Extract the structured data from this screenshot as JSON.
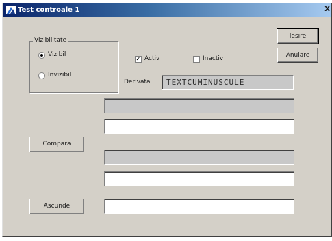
{
  "window": {
    "title": "Test controale 1",
    "close_label": "X"
  },
  "visibility_group": {
    "label": "Vizibilitate",
    "options": [
      {
        "label": "Vizibil",
        "selected": true
      },
      {
        "label": "Invizibil",
        "selected": false
      }
    ]
  },
  "checkboxes": [
    {
      "label": "Activ",
      "checked": true
    },
    {
      "label": "Inactiv",
      "checked": false
    }
  ],
  "buttons": {
    "iesire": "Iesire",
    "anulare": "Anulare",
    "compara": "Compara",
    "ascunde": "Ascunde"
  },
  "derivata": {
    "label": "Derivata",
    "value": "TEXTCUMINUSCULE"
  },
  "icons": {
    "title": "window-app-icon"
  }
}
